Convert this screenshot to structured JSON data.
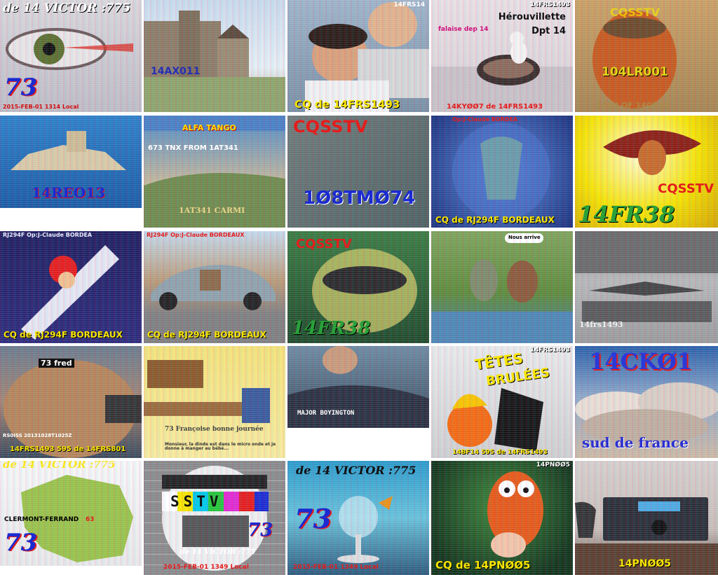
{
  "tiles": [
    {
      "id": "r1c1",
      "texts": {
        "top": "de 14 VICTOR :775",
        "big": "73",
        "date": "2015-FEB-01 1314 Local"
      }
    },
    {
      "id": "r1c2",
      "texts": {
        "call": "14AX011"
      }
    },
    {
      "id": "r1c3",
      "texts": {
        "corner": "14FRS14",
        "bottom": "CQ de 14FRS1493"
      }
    },
    {
      "id": "r1c4",
      "texts": {
        "corner": "14FRS1493",
        "town": "Hérouvillette",
        "dept": "Dpt 14",
        "left": "falaise dep 14",
        "bottom": "14KYØØ7 de 14FRS1493"
      }
    },
    {
      "id": "r1c5",
      "texts": {
        "top": "CQSSTV",
        "call": "104LR001",
        "bottom": "14EN OF 14GR55"
      }
    },
    {
      "id": "r2c1",
      "texts": {
        "call": "14REO13"
      }
    },
    {
      "id": "r2c2",
      "texts": {
        "top": "ALFA TANGO",
        "mid": "673 TNX FROM 1AT341",
        "bottom": "1AT341 CARMI"
      }
    },
    {
      "id": "r2c3",
      "texts": {
        "top": "CQSSTV",
        "call": "1Ø8TMØ74"
      }
    },
    {
      "id": "r2c4",
      "texts": {
        "top": "Op:J-Claude BORDEA",
        "bottom": "CQ de RJ294F BORDEAUX"
      }
    },
    {
      "id": "r2c5",
      "texts": {
        "cq": "CQSSTV",
        "call": "14FR38"
      }
    },
    {
      "id": "r3c1",
      "texts": {
        "top": "RJ294F Op:J-Claude BORDEA",
        "bottom": "CQ de RJ294F BORDEAUX"
      }
    },
    {
      "id": "r3c2",
      "texts": {
        "top": "RJ294F Op:J-Claude BORDEAUX",
        "bottom": "CQ de RJ294F BORDEAUX"
      }
    },
    {
      "id": "r3c3",
      "texts": {
        "top": "CQSSTV",
        "call": "14FR38"
      }
    },
    {
      "id": "r3c4",
      "texts": {
        "bubble": "Nous arrive"
      }
    },
    {
      "id": "r3c5",
      "texts": {
        "call": "14frs1493"
      }
    },
    {
      "id": "r4c1",
      "texts": {
        "tag": "73 fred",
        "small": "RS0ISS 20131028T1025Z",
        "bottom": "14FRS1493 595 de 14FRS801"
      }
    },
    {
      "id": "r4c2",
      "texts": {
        "line1": "73 Françoise bonne journée",
        "line2": "Monsieur, la dinde est dans le micro onde et je donne à manger au bébé..."
      }
    },
    {
      "id": "r4c3",
      "texts": {
        "caption": "MAJOR BOYINGTON"
      }
    },
    {
      "id": "r4c4",
      "texts": {
        "corner": "14FRS1493",
        "title1": "TÊTES",
        "title2": "BRULÉES",
        "bottom": "14BF14 595 de 14FRS1493"
      }
    },
    {
      "id": "r4c5",
      "texts": {
        "call": "14CKØ1",
        "bottom": "sud de france"
      }
    },
    {
      "id": "r5c1",
      "texts": {
        "top": "de 14 VICTOR :775",
        "city": "CLERMONT-FERRAND",
        "num": "63",
        "big": "73"
      }
    },
    {
      "id": "r5c2",
      "texts": {
        "logo": "SSTV",
        "big": "73",
        "call": "de 14 VICTOR :775",
        "date": "2015-FEB-01 1349 Local"
      }
    },
    {
      "id": "r5c3",
      "texts": {
        "top": "de 14 VICTOR :775",
        "big": "73",
        "date": "2015-FEB-01 1349 Local"
      }
    },
    {
      "id": "r5c4",
      "texts": {
        "corner": "14PNØØ5",
        "bottom": "CQ de 14PNØØ5"
      }
    },
    {
      "id": "r5c5",
      "texts": {
        "call": "14PNØØ5"
      }
    }
  ],
  "colors": {
    "yellow": "#f7e400",
    "red": "#e31d1d",
    "blue": "#1f2bd6",
    "white": "#ffffff",
    "sky": "#2a73c9"
  }
}
